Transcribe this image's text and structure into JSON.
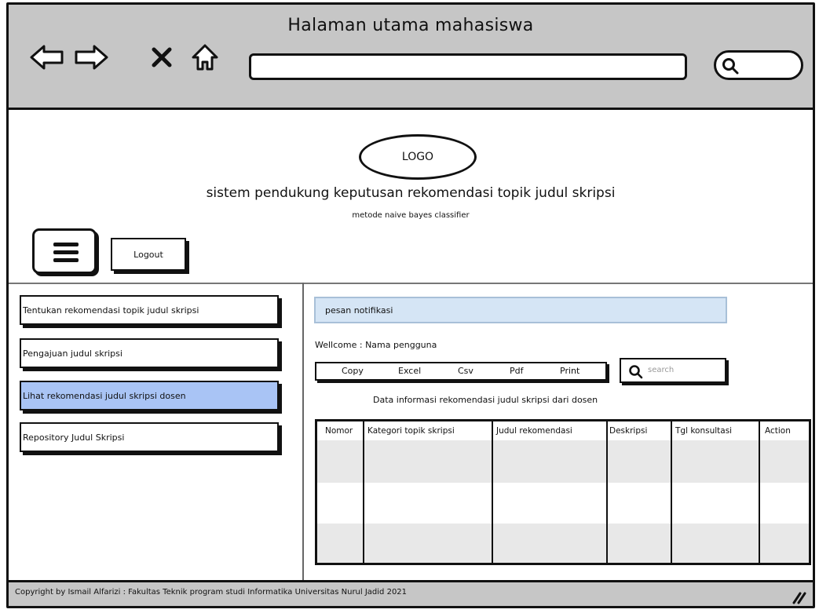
{
  "window": {
    "title": "Halaman utama mahasiswa"
  },
  "header": {
    "logo_text": "LOGO",
    "app_title": "sistem pendukung keputusan rekomendasi topik judul skripsi",
    "app_subtitle": "metode naive bayes classifier",
    "logout_label": "Logout"
  },
  "sidebar": {
    "items": [
      {
        "label": "Tentukan rekomendasi topik judul skripsi",
        "active": false
      },
      {
        "label": "Pengajuan judul skripsi",
        "active": false
      },
      {
        "label": "Lihat rekomendasi judul skripsi dosen",
        "active": true
      },
      {
        "label": "Repository Judul Skripsi",
        "active": false
      }
    ]
  },
  "main": {
    "notification": "pesan notifikasi",
    "welcome": "Wellcome : Nama pengguna",
    "export_buttons": [
      "Copy",
      "Excel",
      "Csv",
      "Pdf",
      "Print"
    ],
    "search_placeholder": "search",
    "table_caption": "Data informasi rekomendasi judul skripsi dari dosen",
    "table": {
      "columns": [
        "Nomor",
        "Kategori topik skripsi",
        "Judul rekomendasi",
        "Deskripsi",
        "Tgl konsultasi",
        "Action"
      ]
    }
  },
  "footer": {
    "copyright": "Copyright by Ismail Alfarizi : Fakultas Teknik program studi Informatika Universitas Nurul Jadid 2021"
  },
  "colors": {
    "chrome": "#c6c6c6",
    "active_item": "#a9c4f5",
    "notification_bg": "#d5e5f5"
  },
  "icons": [
    "back-arrow-icon",
    "forward-arrow-icon",
    "close-icon",
    "home-icon",
    "search-icon",
    "menu-icon",
    "resize-handle-icon"
  ]
}
